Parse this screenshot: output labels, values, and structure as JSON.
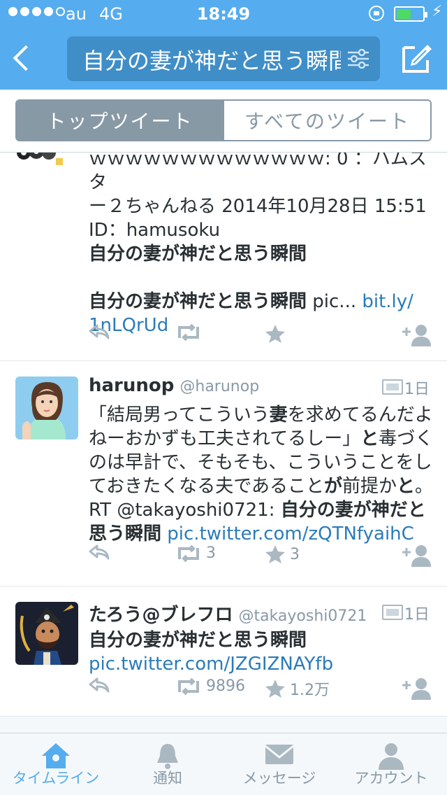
{
  "status_bar": {
    "carrier": "au",
    "network": "4G",
    "time": "18:49",
    "battery_color": "#4cd964"
  },
  "header": {
    "search_query": "自分の妻が神だと思う瞬間",
    "accent": "#55acee"
  },
  "segments": {
    "top": "トップツイート",
    "all": "すべてのツイート"
  },
  "tweets": [
    {
      "lines": [
        "ｗｗｗｗｗｗｗｗｗｗｗｗｗ: 0 ：ハムスタ",
        "ー２ちゃんねる 2014年10月28日 15:51",
        "ID：hamusoku"
      ],
      "bold1": "自分の妻が神だと思う瞬間",
      "bold2": "自分の妻が神だと思う瞬間",
      "tail": " pic... ",
      "link1": "bit.ly/",
      "link2": "1nLQrUd"
    },
    {
      "name": "harunop",
      "handle": "@harunop",
      "age": "1日",
      "t1": "「結局男ってこういう",
      "b1": "妻",
      "t2": "を求めてるんだよねーおかずも工夫されてるしー」",
      "b2": "と",
      "t3": "毒づくのは早計で、そもそも、こういうことをしておきたくなる夫であること",
      "b3": "が",
      "t4": "前提か",
      "b4": "と",
      "t5": "。RT @takayoshi0721: ",
      "b5": "自分の妻が神だと思う瞬間",
      "link": "pic.twitter.com/zQTNfyaihC",
      "retweets": "3",
      "favorites": "3"
    },
    {
      "name": "たろう@ブレフロ",
      "handle": "@takayoshi0721",
      "age": "1日",
      "bold": "自分の妻が神だと思う瞬間",
      "link": "pic.twitter.com/JZGIZNAYfb",
      "retweets": "9896",
      "favorites": "1.2万"
    }
  ],
  "tabbar": {
    "timeline": "タイムライン",
    "notifications": "通知",
    "messages": "メッセージ",
    "account": "アカウント"
  }
}
